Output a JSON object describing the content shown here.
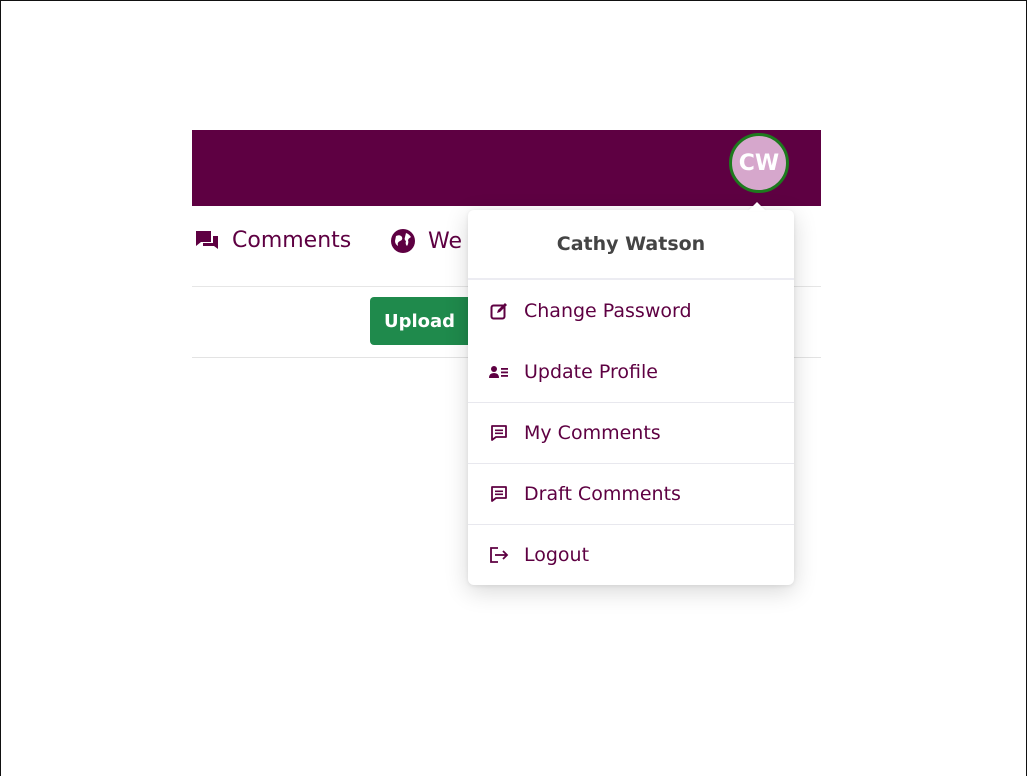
{
  "user": {
    "initials": "CW",
    "name": "Cathy Watson"
  },
  "nav": {
    "items": [
      {
        "label": "Comments",
        "icon": "comments-icon"
      },
      {
        "label": "We",
        "icon": "globe-icon"
      }
    ]
  },
  "toolbar": {
    "upload_label": "Upload"
  },
  "dropdown": {
    "items": [
      {
        "label": "Change Password",
        "icon": "edit-square-icon"
      },
      {
        "label": "Update Profile",
        "icon": "id-card-icon"
      },
      {
        "label": "My Comments",
        "icon": "message-square-icon"
      },
      {
        "label": "Draft Comments",
        "icon": "message-square-icon"
      },
      {
        "label": "Logout",
        "icon": "logout-icon"
      }
    ]
  },
  "colors": {
    "brand": "#5e0042",
    "avatar_bg": "#d6a7cc",
    "avatar_ring": "#1d7a1d",
    "button_green": "#1f8a4c"
  }
}
